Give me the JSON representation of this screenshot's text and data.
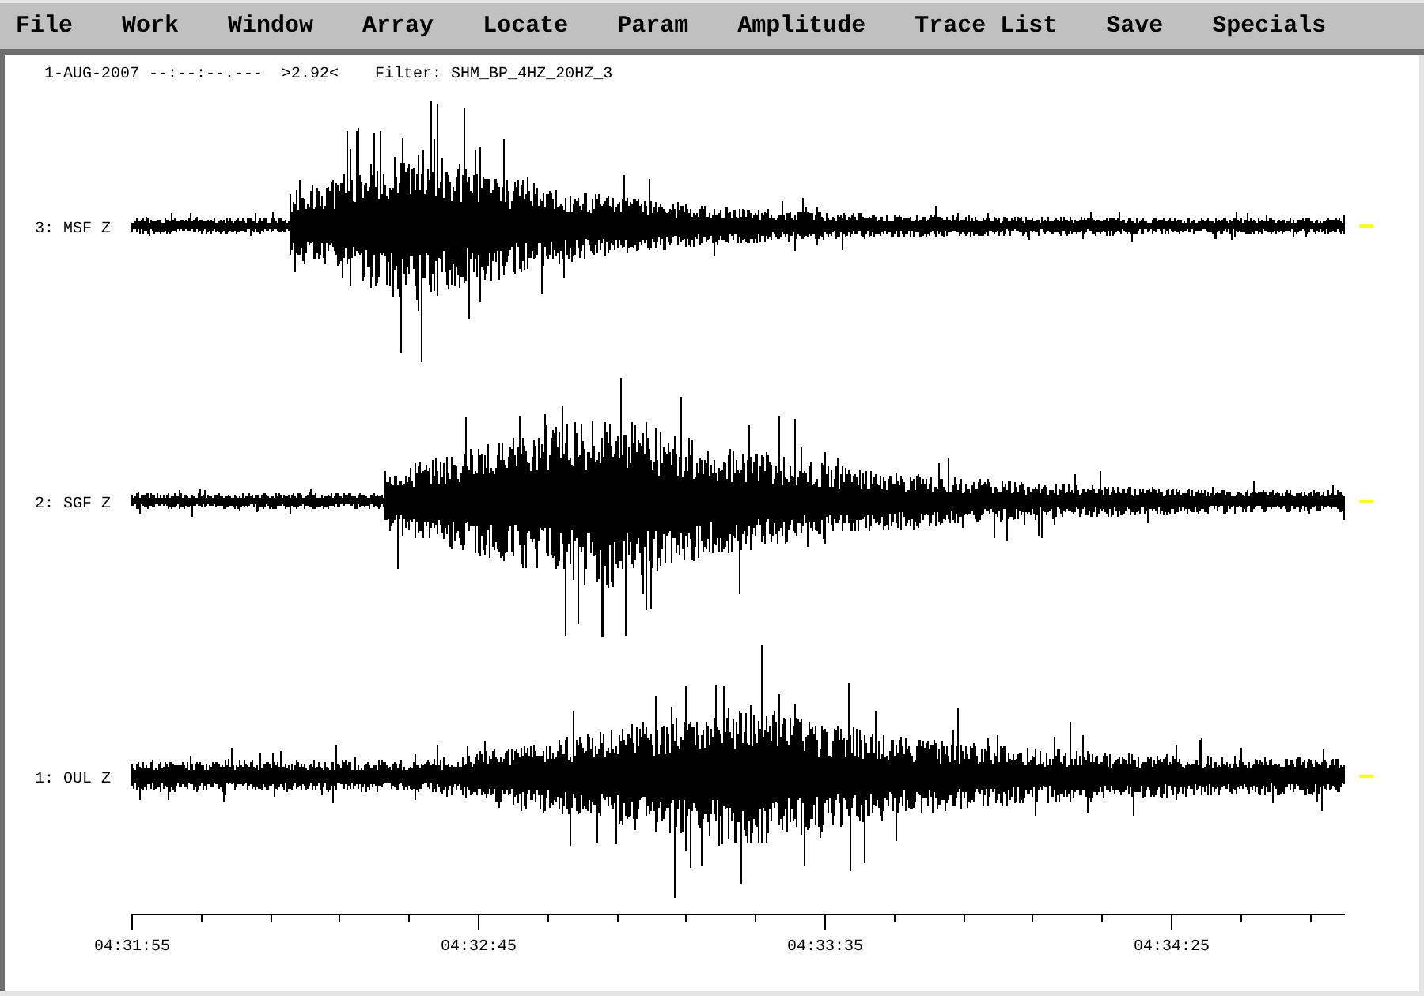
{
  "menu": [
    "File",
    "Work",
    "Window",
    "Array",
    "Locate",
    "Param",
    "Amplitude",
    "Trace List",
    "Save",
    "Specials"
  ],
  "header": {
    "date_time": "1-AUG-2007 --:--:--.---",
    "amplitude": ">2.92<",
    "filter": "Filter: SHM_BP_4HZ_20HZ_3"
  },
  "traces": [
    {
      "label": "3: MSF Z"
    },
    {
      "label": "2: SGF Z"
    },
    {
      "label": "1: OUL Z"
    }
  ],
  "time_axis": {
    "labels": [
      "04:31:55",
      "04:32:45",
      "04:33:35",
      "04:34:25"
    ]
  }
}
